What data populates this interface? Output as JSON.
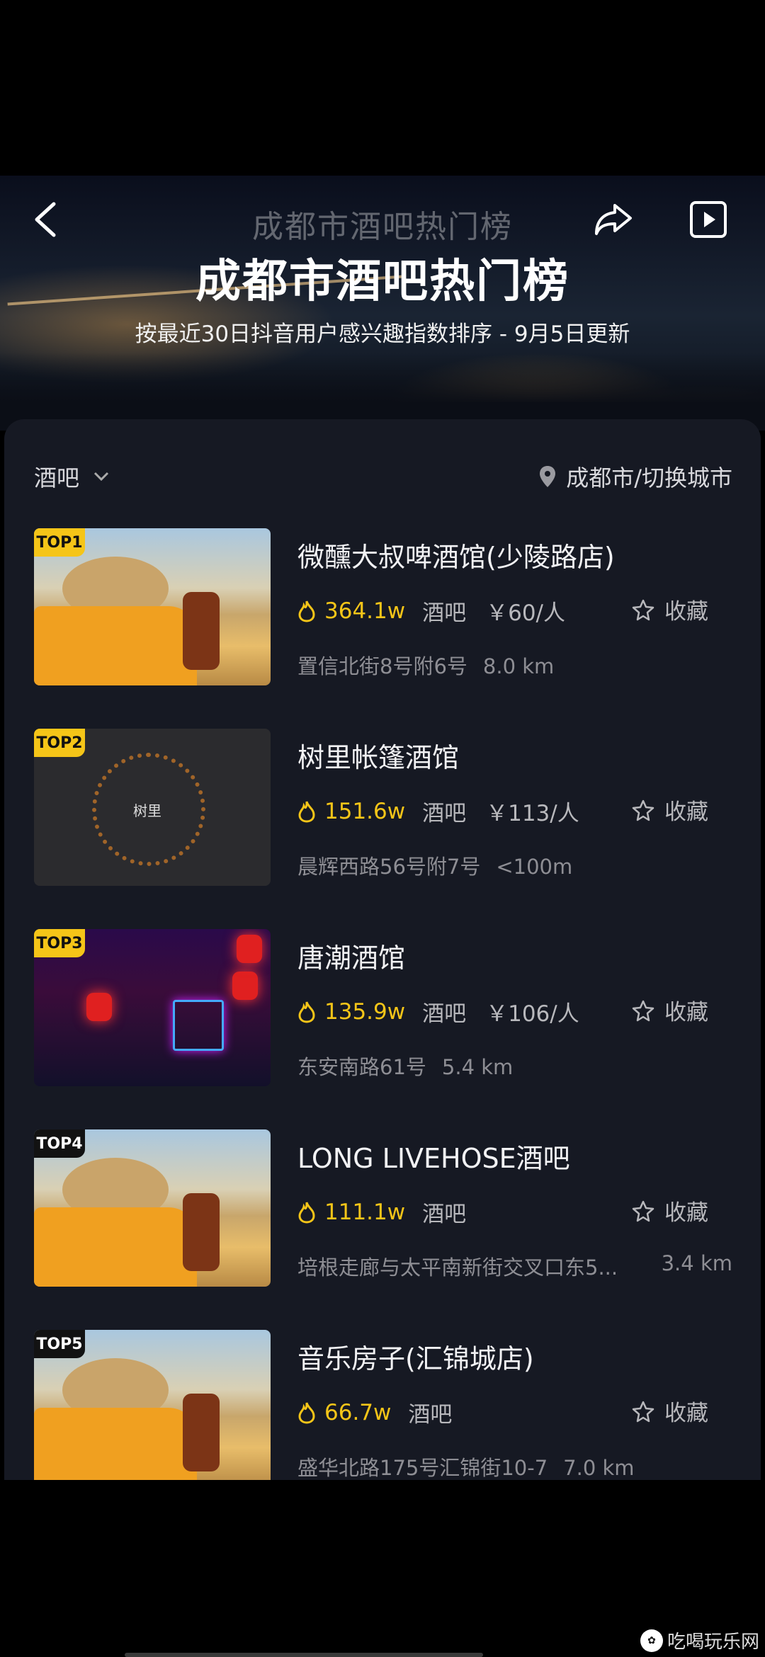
{
  "header": {
    "ghost_title": "成都市酒吧热门榜",
    "title": "成都市酒吧热门榜",
    "subtitle": "按最近30日抖音用户感兴趣指数排序 - 9月5日更新",
    "icons": [
      "back-icon",
      "share-icon",
      "play-icon"
    ]
  },
  "filters": {
    "category": "酒吧",
    "city": "成都市/切换城市"
  },
  "items": [
    {
      "rank": "TOP1",
      "name": "微醺大叔啤酒馆(少陵路店)",
      "heat": "364.1w",
      "category": "酒吧",
      "price": "￥60/人",
      "fav": "收藏",
      "address": "置信北街8号附6号",
      "distance": "8.0 km"
    },
    {
      "rank": "TOP2",
      "name": "树里帐篷酒馆",
      "heat": "151.6w",
      "category": "酒吧",
      "price": "￥113/人",
      "fav": "收藏",
      "address": "晨辉西路56号附7号",
      "distance": "<100m"
    },
    {
      "rank": "TOP3",
      "name": "唐潮酒馆",
      "heat": "135.9w",
      "category": "酒吧",
      "price": "￥106/人",
      "fav": "收藏",
      "address": "东安南路61号",
      "distance": "5.4 km"
    },
    {
      "rank": "TOP4",
      "name": "LONG LIVEHOSE酒吧",
      "heat": "111.1w",
      "category": "酒吧",
      "price": "",
      "fav": "收藏",
      "address": "培根走廊与太平南新街交叉口东5...",
      "distance": "3.4 km"
    },
    {
      "rank": "TOP5",
      "name": "音乐房子(汇锦城店)",
      "heat": "66.7w",
      "category": "酒吧",
      "price": "",
      "fav": "收藏",
      "address": "盛华北路175号汇锦街10-7",
      "distance": "7.0 km"
    }
  ],
  "thumb_logo_text": "树里",
  "watermark": "吃喝玩乐网",
  "colors": {
    "accent": "#f5c518",
    "panel": "#161923",
    "background": "#000000"
  }
}
